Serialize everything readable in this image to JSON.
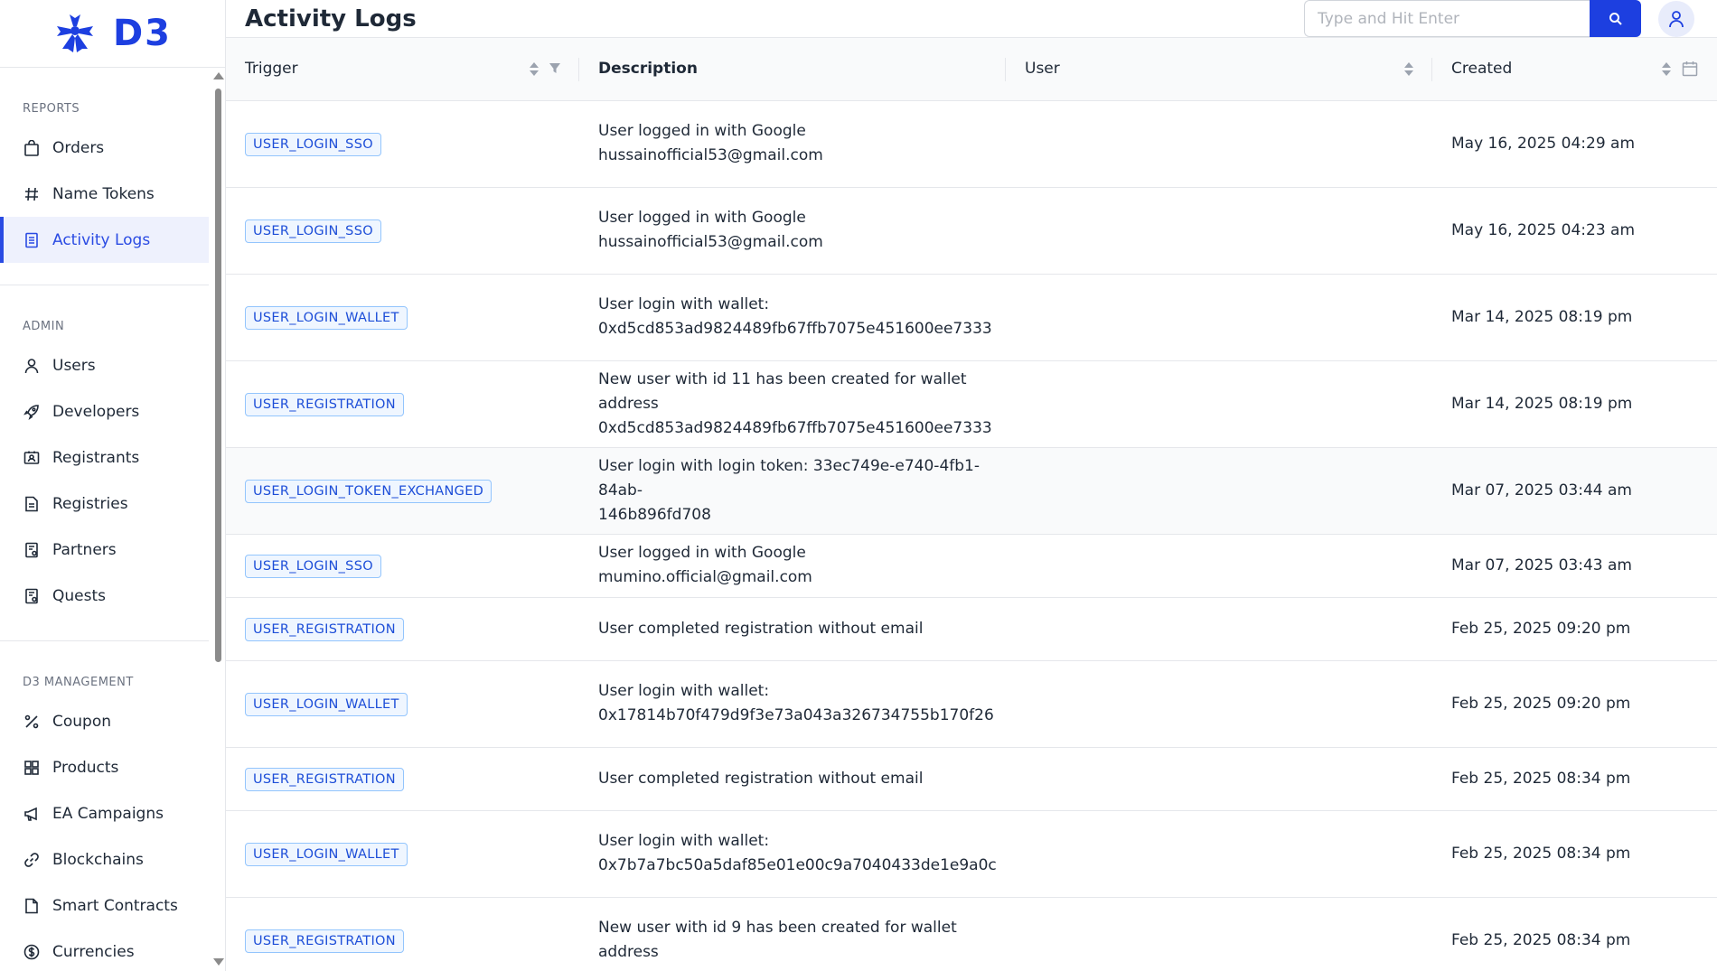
{
  "brand": {
    "wordmark": "D3",
    "accent": "#1d3fe0"
  },
  "sidebar": {
    "sections": [
      {
        "title": "REPORTS",
        "items": [
          {
            "label": "Orders",
            "icon": "shopping-bag-icon"
          },
          {
            "label": "Name Tokens",
            "icon": "hash-icon"
          },
          {
            "label": "Activity Logs",
            "icon": "list-icon",
            "active": true
          }
        ]
      },
      {
        "title": "ADMIN",
        "items": [
          {
            "label": "Users",
            "icon": "user-icon"
          },
          {
            "label": "Developers",
            "icon": "rocket-icon"
          },
          {
            "label": "Registrants",
            "icon": "id-card-icon"
          },
          {
            "label": "Registries",
            "icon": "document-icon"
          },
          {
            "label": "Partners",
            "icon": "clipboard-icon"
          },
          {
            "label": "Quests",
            "icon": "clipboard-icon"
          }
        ]
      },
      {
        "title": "D3 MANAGEMENT",
        "items": [
          {
            "label": "Coupon",
            "icon": "percent-icon"
          },
          {
            "label": "Products",
            "icon": "grid-icon"
          },
          {
            "label": "EA Campaigns",
            "icon": "megaphone-icon"
          },
          {
            "label": "Blockchains",
            "icon": "link-icon"
          },
          {
            "label": "Smart Contracts",
            "icon": "file-icon"
          },
          {
            "label": "Currencies",
            "icon": "dollar-icon"
          }
        ]
      }
    ]
  },
  "header": {
    "title": "Activity Logs",
    "search_placeholder": "Type and Hit Enter"
  },
  "table": {
    "columns": [
      "Trigger",
      "Description",
      "User",
      "Created"
    ],
    "rows": [
      {
        "trigger": "USER_LOGIN_SSO",
        "desc1": "User logged in with Google",
        "desc2": "hussainofficial53@gmail.com",
        "user": "",
        "created": "May 16, 2025 04:29 am"
      },
      {
        "trigger": "USER_LOGIN_SSO",
        "desc1": "User logged in with Google",
        "desc2": "hussainofficial53@gmail.com",
        "user": "",
        "created": "May 16, 2025 04:23 am"
      },
      {
        "trigger": "USER_LOGIN_WALLET",
        "desc1": "User login with wallet:",
        "desc2": "0xd5cd853ad9824489fb67ffb7075e451600ee7333",
        "user": "",
        "created": "Mar 14, 2025 08:19 pm"
      },
      {
        "trigger": "USER_REGISTRATION",
        "desc1": "New user with id 11 has been created for wallet address",
        "desc2": "0xd5cd853ad9824489fb67ffb7075e451600ee7333",
        "user": "",
        "created": "Mar 14, 2025 08:19 pm"
      },
      {
        "trigger": "USER_LOGIN_TOKEN_EXCHANGED",
        "desc1": "User login with login token: 33ec749e-e740-4fb1-84ab-",
        "desc2": "146b896fd708",
        "user": "",
        "created": "Mar 07, 2025 03:44 am",
        "highlight": true
      },
      {
        "trigger": "USER_LOGIN_SSO",
        "desc1": "User logged in with Google mumino.official@gmail.com",
        "desc2": "",
        "user": "",
        "created": "Mar 07, 2025 03:43 am"
      },
      {
        "trigger": "USER_REGISTRATION",
        "desc1": "User completed registration without email",
        "desc2": "",
        "user": "",
        "created": "Feb 25, 2025 09:20 pm"
      },
      {
        "trigger": "USER_LOGIN_WALLET",
        "desc1": "User login with wallet:",
        "desc2": "0x17814b70f479d9f3e73a043a326734755b170f26",
        "user": "",
        "created": "Feb 25, 2025 09:20 pm"
      },
      {
        "trigger": "USER_REGISTRATION",
        "desc1": "User completed registration without email",
        "desc2": "",
        "user": "",
        "created": "Feb 25, 2025 08:34 pm"
      },
      {
        "trigger": "USER_LOGIN_WALLET",
        "desc1": "User login with wallet:",
        "desc2": "0x7b7a7bc50a5daf85e01e00c9a7040433de1e9a0c",
        "user": "",
        "created": "Feb 25, 2025 08:34 pm"
      },
      {
        "trigger": "USER_REGISTRATION",
        "desc1": "New user with id 9 has been created for wallet address",
        "desc2": "",
        "user": "",
        "created": "Feb 25, 2025 08:34 pm"
      }
    ]
  }
}
